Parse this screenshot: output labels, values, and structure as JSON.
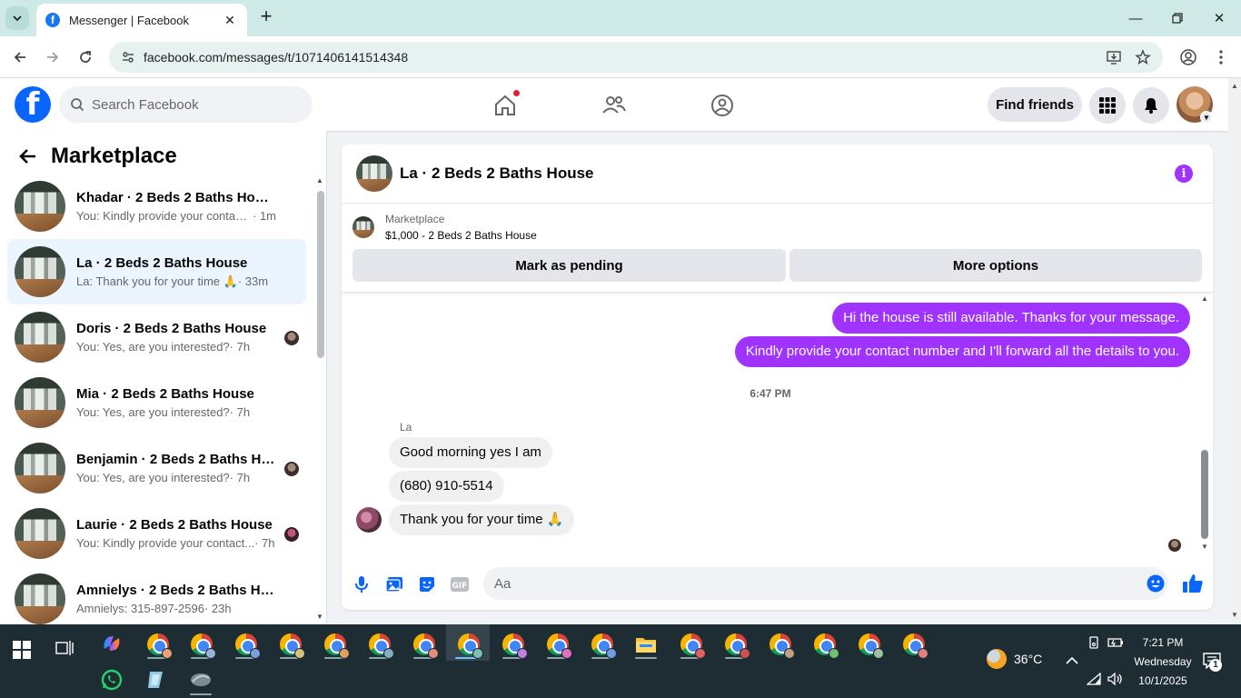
{
  "browser": {
    "tab_title": "Messenger | Facebook",
    "url": "facebook.com/messages/t/1071406141514348"
  },
  "fb": {
    "search_placeholder": "Search Facebook",
    "find_friends": "Find friends"
  },
  "sidebar": {
    "title": "Marketplace",
    "conversations": [
      {
        "name": "Khadar · 2 Beds 2 Baths House",
        "snippet": "You: Kindly provide your contact n...",
        "time": " · 1m",
        "active": false,
        "read_avatar": false
      },
      {
        "name": "La · 2 Beds 2 Baths House",
        "snippet": "La: Thank you for your time 🙏",
        "time": " · 33m",
        "active": true,
        "read_avatar": false
      },
      {
        "name": "Doris · 2 Beds 2 Baths House",
        "snippet": "You: Yes, are you interested?",
        "time": " · 7h",
        "active": false,
        "read_avatar": true
      },
      {
        "name": "Mia · 2 Beds 2 Baths House",
        "snippet": "You: Yes, are you interested?",
        "time": " · 7h",
        "active": false,
        "read_avatar": false
      },
      {
        "name": "Benjamin · 2 Beds 2 Baths Ho...",
        "snippet": "You: Yes, are you interested?",
        "time": " · 7h",
        "active": false,
        "read_avatar": true
      },
      {
        "name": "Laurie · 2 Beds 2 Baths House",
        "snippet": "You: Kindly provide your contact...",
        "time": " · 7h",
        "active": false,
        "read_avatar": true
      },
      {
        "name": "Amnielys · 2 Beds 2 Baths House",
        "snippet": "Amnielys: 315-897-2596",
        "time": " · 23h",
        "active": false,
        "read_avatar": false
      }
    ]
  },
  "chat": {
    "title": "La · 2 Beds 2 Baths House",
    "marketplace_label": "Marketplace",
    "listing": "$1,000 - 2 Beds 2 Baths House",
    "mark_pending": "Mark as pending",
    "more_options": "More options",
    "out_messages": [
      "Hi the house is still available. Thanks for your message.",
      "Kindly provide your contact number and I'll forward all the details to you."
    ],
    "timestamp": "6:47 PM",
    "sender": "La",
    "in_messages": [
      "Good morning yes I am",
      "(680) 910-5514",
      "Thank you for your time 🙏"
    ],
    "composer_placeholder": "Aa"
  },
  "taskbar": {
    "temperature": "36°C",
    "time": "7:21 PM",
    "day": "Wednesday",
    "date": "10/1/2025",
    "notification_count": "1"
  },
  "colors": {
    "messenger_purple": "#a033ff",
    "fb_blue": "#0866ff",
    "active_row": "#ebf5ff"
  }
}
